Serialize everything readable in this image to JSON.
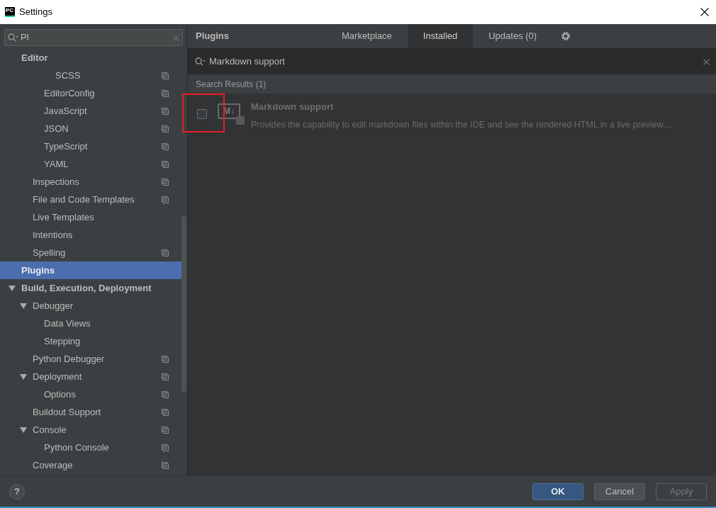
{
  "window": {
    "title": "Settings",
    "app_icon": "PC"
  },
  "sidebar": {
    "search": {
      "value": "Pl"
    },
    "items": [
      {
        "label": "Editor",
        "selected": false,
        "children": [
          {
            "children": [
              {
                "children": [
                  {
                    "label": "SCSS",
                    "selected": false,
                    "project_level": true
                  }
                ]
              },
              {
                "label": "EditorConfig",
                "selected": false,
                "project_level": true
              },
              {
                "label": "JavaScript",
                "selected": false,
                "project_level": true
              },
              {
                "label": "JSON",
                "selected": false,
                "project_level": true
              },
              {
                "label": "TypeScript",
                "selected": false,
                "project_level": true
              },
              {
                "label": "YAML",
                "selected": false,
                "project_level": true
              }
            ]
          },
          {
            "label": "Inspections",
            "selected": false,
            "project_level": true
          },
          {
            "label": "File and Code Templates",
            "selected": false,
            "project_level": true
          },
          {
            "label": "Live Templates",
            "selected": false,
            "project_level": false
          },
          {
            "label": "Intentions",
            "selected": false,
            "project_level": false
          },
          {
            "label": "Spelling",
            "selected": false,
            "project_level": true
          }
        ]
      },
      {
        "label": "Plugins",
        "selected": true
      },
      {
        "label": "Build, Execution, Deployment",
        "selected": false,
        "expanded": true,
        "children": [
          {
            "label": "Debugger",
            "selected": false,
            "expanded": true,
            "children": [
              {
                "label": "Data Views",
                "selected": false,
                "project_level": false
              },
              {
                "label": "Stepping",
                "selected": false,
                "project_level": false
              }
            ]
          },
          {
            "label": "Python Debugger",
            "selected": false,
            "project_level": true
          },
          {
            "label": "Deployment",
            "selected": false,
            "expanded": true,
            "project_level": true,
            "children": [
              {
                "label": "Options",
                "selected": false,
                "project_level": true
              }
            ]
          },
          {
            "label": "Buildout Support",
            "selected": false,
            "project_level": true
          },
          {
            "label": "Console",
            "selected": false,
            "expanded": true,
            "project_level": true,
            "children": [
              {
                "label": "Python Console",
                "selected": false,
                "project_level": true
              }
            ]
          },
          {
            "label": "Coverage",
            "selected": false,
            "project_level": true
          }
        ]
      }
    ]
  },
  "plugins": {
    "title": "Plugins",
    "tabs": [
      {
        "label": "Marketplace",
        "selected": false
      },
      {
        "label": "Installed",
        "selected": true
      },
      {
        "label": "Updates (0)",
        "selected": false
      }
    ],
    "search": {
      "value": "Markdown support"
    },
    "results_heading": "Search Results (1)",
    "results": [
      {
        "name": "Markdown support",
        "description": "Provides the capability to edit markdown files within the IDE and see the rendered HTML in a live preview....",
        "logo": "M↓",
        "checked": false,
        "highlighted": true
      }
    ]
  },
  "buttons": [
    {
      "label": "OK",
      "kind": "default"
    },
    {
      "label": "Cancel",
      "kind": "normal"
    },
    {
      "label": "Apply",
      "kind": "disabled"
    }
  ],
  "help": "?"
}
